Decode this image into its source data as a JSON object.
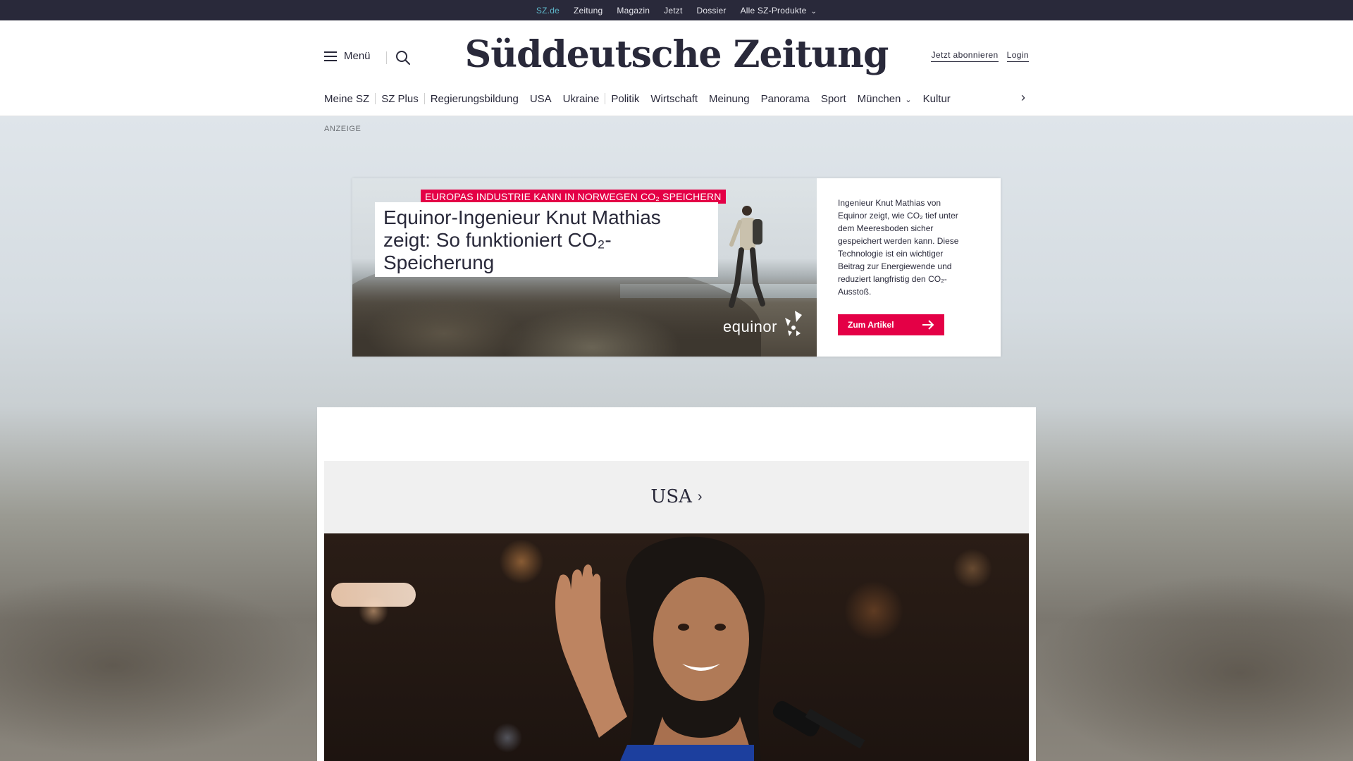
{
  "topbar": {
    "links": [
      "SZ.de",
      "Zeitung",
      "Magazin",
      "Jetzt",
      "Dossier",
      "Alle SZ-Produkte"
    ]
  },
  "header": {
    "menu_label": "Menü",
    "logo": "Süddeutsche Zeitung",
    "subscribe": "Jetzt abonnieren",
    "login": "Login"
  },
  "nav": {
    "items": [
      "Meine SZ",
      "SZ Plus",
      "Regierungsbildung",
      "USA",
      "Ukraine",
      "Politik",
      "Wirtschaft",
      "Meinung",
      "Panorama",
      "Sport",
      "München",
      "Kultur"
    ]
  },
  "ad": {
    "label": "ANZEIGE",
    "kicker": "EUROPAS INDUSTRIE KANN IN NORWEGEN CO₂ SPEICHERN",
    "headline": "Equinor-Ingenieur Knut Mathias zeigt: So funktioniert CO₂-Speicherung",
    "brand": "equinor",
    "text": "Ingenieur Knut Mathias von Equinor zeigt, wie CO₂ tief unter dem Meeresboden sicher gespeichert werden kann. Diese Technologie ist ein wichtiger Beitrag zur Energiewende und reduziert langfristig den CO₂-Ausstoß.",
    "cta": "Zum Artikel"
  },
  "section": {
    "title": "USA",
    "arrow": "›"
  },
  "icons": {
    "menu": "hamburger-icon",
    "search": "search-icon",
    "nav_next": "chevron-right-icon",
    "dropdown": "chevron-down-icon",
    "cta_arrow": "arrow-right-icon"
  },
  "colors": {
    "brand_dark": "#29293a",
    "accent_red": "#e40046",
    "active_link": "#5db6c9"
  }
}
